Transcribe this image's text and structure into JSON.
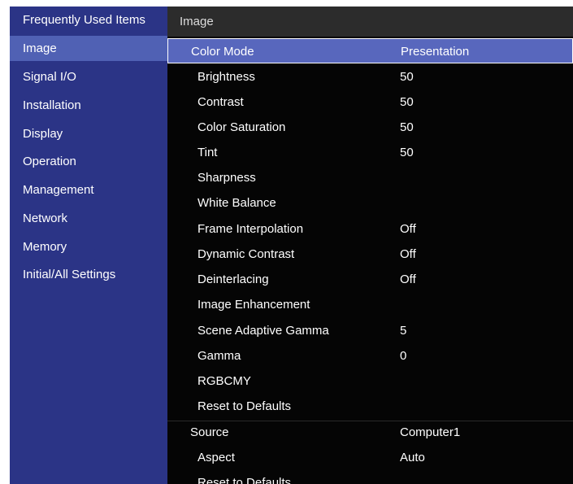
{
  "sidebar": {
    "items": [
      {
        "label": "Frequently Used Items",
        "name": "sidebar-item-frequently-used-items"
      },
      {
        "label": "Image",
        "name": "sidebar-item-image",
        "active": true
      },
      {
        "label": "Signal I/O",
        "name": "sidebar-item-signal-io"
      },
      {
        "label": "Installation",
        "name": "sidebar-item-installation"
      },
      {
        "label": "Display",
        "name": "sidebar-item-display"
      },
      {
        "label": "Operation",
        "name": "sidebar-item-operation"
      },
      {
        "label": "Management",
        "name": "sidebar-item-management"
      },
      {
        "label": "Network",
        "name": "sidebar-item-network"
      },
      {
        "label": "Memory",
        "name": "sidebar-item-memory"
      },
      {
        "label": "Initial/All Settings",
        "name": "sidebar-item-initial-all-settings"
      }
    ]
  },
  "main": {
    "header": "Image",
    "rows": [
      {
        "label": "Color Mode",
        "value": "Presentation",
        "level": 1,
        "active": true,
        "name": "menu-row-color-mode"
      },
      {
        "label": "Brightness",
        "value": "50",
        "level": 2,
        "name": "menu-row-brightness"
      },
      {
        "label": "Contrast",
        "value": "50",
        "level": 2,
        "name": "menu-row-contrast"
      },
      {
        "label": "Color Saturation",
        "value": "50",
        "level": 2,
        "name": "menu-row-color-saturation"
      },
      {
        "label": "Tint",
        "value": "50",
        "level": 2,
        "name": "menu-row-tint"
      },
      {
        "label": "Sharpness",
        "value": "",
        "level": 2,
        "name": "menu-row-sharpness"
      },
      {
        "label": "White Balance",
        "value": "",
        "level": 2,
        "name": "menu-row-white-balance"
      },
      {
        "label": "Frame Interpolation",
        "value": "Off",
        "level": 2,
        "name": "menu-row-frame-interpolation"
      },
      {
        "label": "Dynamic Contrast",
        "value": "Off",
        "level": 2,
        "name": "menu-row-dynamic-contrast"
      },
      {
        "label": "Deinterlacing",
        "value": "Off",
        "level": 2,
        "name": "menu-row-deinterlacing"
      },
      {
        "label": "Image Enhancement",
        "value": "",
        "level": 2,
        "name": "menu-row-image-enhancement"
      },
      {
        "label": "Scene Adaptive Gamma",
        "value": "5",
        "level": 2,
        "name": "menu-row-scene-adaptive-gamma"
      },
      {
        "label": "Gamma",
        "value": "0",
        "level": 2,
        "name": "menu-row-gamma"
      },
      {
        "label": "RGBCMY",
        "value": "",
        "level": 2,
        "name": "menu-row-rgbcmy"
      },
      {
        "label": "Reset to Defaults",
        "value": "",
        "level": 2,
        "name": "menu-row-reset-to-defaults-1"
      },
      {
        "label": "Source",
        "value": "Computer1",
        "level": 1,
        "name": "menu-row-source"
      },
      {
        "label": "Aspect",
        "value": "Auto",
        "level": 2,
        "name": "menu-row-aspect"
      },
      {
        "label": "Reset to Defaults",
        "value": "",
        "level": 2,
        "name": "menu-row-reset-to-defaults-2"
      }
    ]
  },
  "colors": {
    "sidebar_bg": "#2b3486",
    "sidebar_active_bg": "#5061b4",
    "main_bg": "#050505",
    "header_bg": "#2c2c2c",
    "row_active_bg": "#5867bd"
  }
}
